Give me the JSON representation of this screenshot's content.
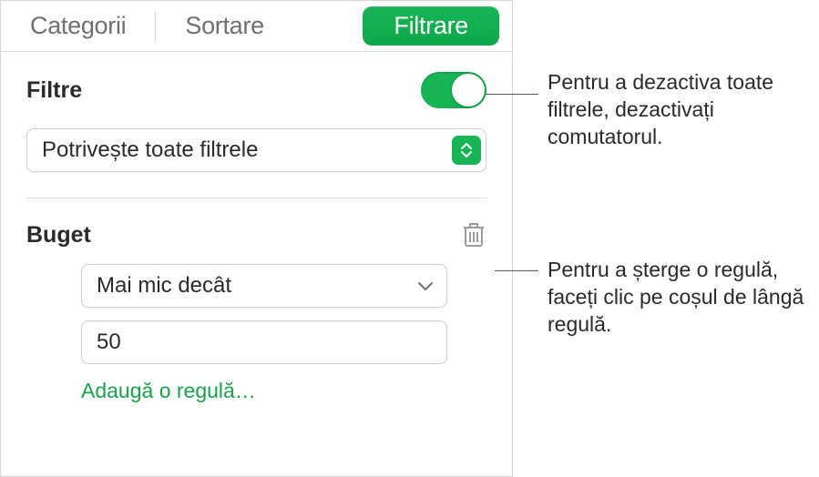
{
  "tabs": {
    "categories": "Categorii",
    "sort": "Sortare",
    "filter": "Filtrare"
  },
  "filters": {
    "heading": "Filtre",
    "match_mode": "Potrivește toate filtrele"
  },
  "rule": {
    "column": "Buget",
    "operator": "Mai mic decât",
    "value": "50",
    "add_label": "Adaugă o regulă…"
  },
  "callouts": {
    "toggle": "Pentru a dezactiva toate filtrele, dezactivați comutatorul.",
    "trash": "Pentru a șterge o regulă, faceți clic pe coșul de lângă regulă."
  }
}
